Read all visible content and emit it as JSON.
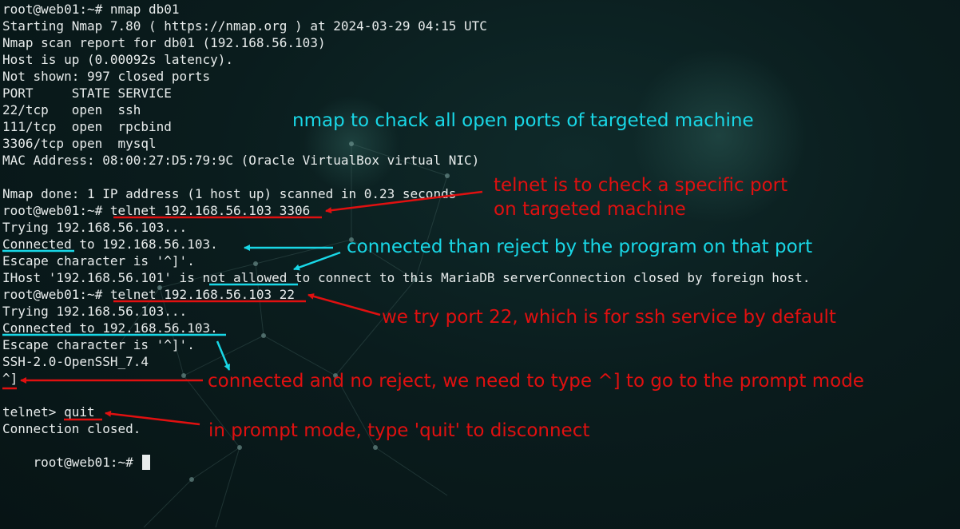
{
  "colors": {
    "terminal_text": "#e8ecec",
    "annotation_red": "#e01010",
    "annotation_cyan": "#19d7e6",
    "background": "#0a1c1d"
  },
  "terminal": {
    "lines": [
      "root@web01:~# nmap db01",
      "Starting Nmap 7.80 ( https://nmap.org ) at 2024-03-29 04:15 UTC",
      "Nmap scan report for db01 (192.168.56.103)",
      "Host is up (0.00092s latency).",
      "Not shown: 997 closed ports",
      "PORT     STATE SERVICE",
      "22/tcp   open  ssh",
      "111/tcp  open  rpcbind",
      "3306/tcp open  mysql",
      "MAC Address: 08:00:27:D5:79:9C (Oracle VirtualBox virtual NIC)",
      "",
      "Nmap done: 1 IP address (1 host up) scanned in 0.23 seconds",
      "root@web01:~# telnet 192.168.56.103 3306",
      "Trying 192.168.56.103...",
      "Connected to 192.168.56.103.",
      "Escape character is '^]'.",
      "IHost '192.168.56.101' is not allowed to connect to this MariaDB serverConnection closed by foreign host.",
      "root@web01:~# telnet 192.168.56.103 22",
      "Trying 192.168.56.103...",
      "Connected to 192.168.56.103.",
      "Escape character is '^]'.",
      "SSH-2.0-OpenSSH_7.4",
      "^]",
      "",
      "telnet> quit",
      "Connection closed.",
      "root@web01:~# "
    ]
  },
  "annotations": {
    "nmap_note": "nmap to chack all open ports of targeted machine",
    "telnet_note_1": "telnet is to check a specific port",
    "telnet_note_2": "on targeted machine",
    "connected_reject_note": "connected than reject by the program on that port",
    "port22_note": "we try port 22, which is for ssh service by default",
    "no_reject_note": "connected and no reject, we need to type ^] to go to the prompt mode",
    "quit_note": "in prompt mode, type 'quit' to disconnect"
  }
}
